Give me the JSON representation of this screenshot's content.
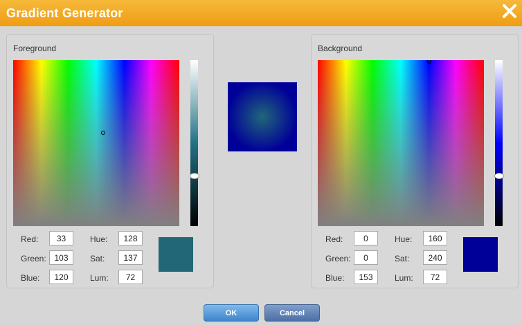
{
  "window": {
    "title": "Gradient Generator"
  },
  "foreground": {
    "title": "Foreground",
    "red_label": "Red:",
    "red": "33",
    "green_label": "Green:",
    "green": "103",
    "blue_label": "Blue:",
    "blue": "120",
    "hue_label": "Hue:",
    "hue": "128",
    "sat_label": "Sat:",
    "sat": "137",
    "lum_label": "Lum:",
    "lum": "72",
    "color": "#216778"
  },
  "background": {
    "title": "Background",
    "red_label": "Red:",
    "red": "0",
    "green_label": "Green:",
    "green": "0",
    "blue_label": "Blue:",
    "blue": "153",
    "hue_label": "Hue:",
    "hue": "160",
    "sat_label": "Sat:",
    "sat": "240",
    "lum_label": "Lum:",
    "lum": "72",
    "color": "#000099"
  },
  "buttons": {
    "ok": "OK",
    "cancel": "Cancel"
  },
  "colors": {
    "titlebar": "#f0a21a",
    "accent_button": "#4a8fd4"
  }
}
